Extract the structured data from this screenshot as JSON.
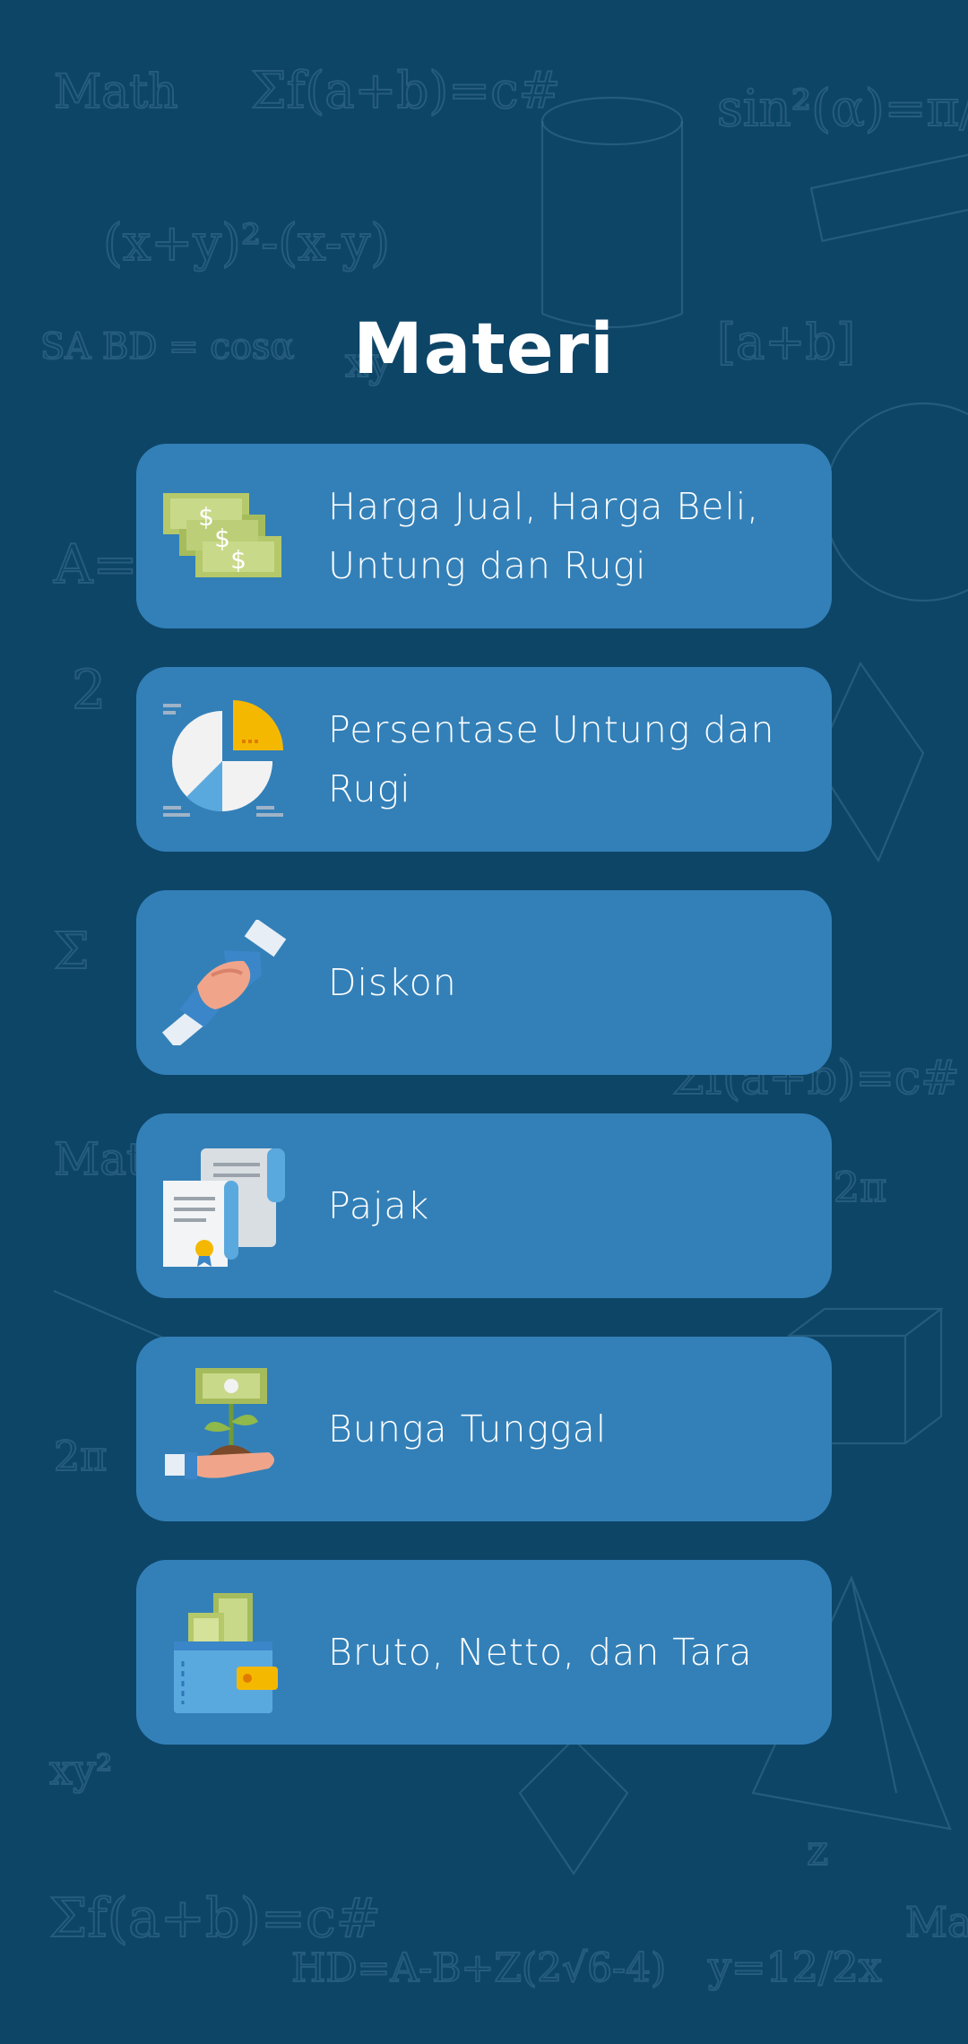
{
  "page": {
    "title": "Materi"
  },
  "menu": {
    "items": [
      {
        "label": "Harga Jual, Harga Beli, Untung dan Rugi",
        "icon": "money-stack-icon"
      },
      {
        "label": "Persentase Untung dan Rugi",
        "icon": "pie-chart-icon"
      },
      {
        "label": "Diskon",
        "icon": "handshake-icon"
      },
      {
        "label": "Pajak",
        "icon": "document-certificate-icon"
      },
      {
        "label": "Bunga Tunggal",
        "icon": "money-plant-hand-icon"
      },
      {
        "label": "Bruto, Netto, dan Tara",
        "icon": "wallet-money-icon"
      }
    ]
  },
  "colors": {
    "background": "#0d4567",
    "card": "#3380b8",
    "text": "#ffffff"
  }
}
